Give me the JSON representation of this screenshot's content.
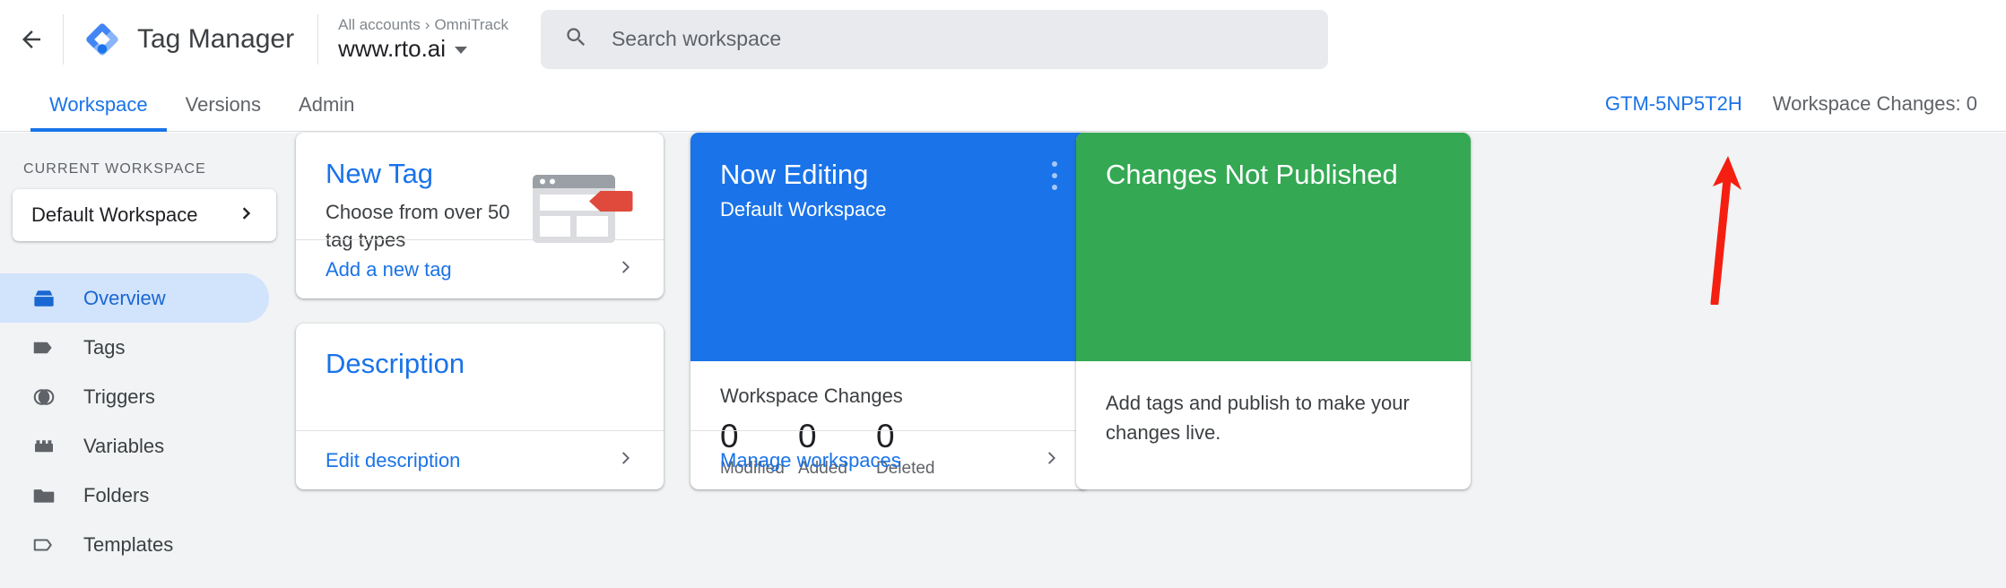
{
  "topbar": {
    "back_icon": "arrow-left-icon",
    "logo_icon": "tag-manager-logo",
    "product_title": "Tag Manager",
    "breadcrumb_root": "All accounts",
    "breadcrumb_sep": "›",
    "breadcrumb_account": "OmniTrack",
    "container_name": "www.rto.ai",
    "container_dropdown_icon": "chevron-down-icon",
    "search": {
      "icon": "search-icon",
      "placeholder": "Search workspace"
    }
  },
  "tabbar": {
    "tabs": [
      {
        "label": "Workspace",
        "active": true
      },
      {
        "label": "Versions",
        "active": false
      },
      {
        "label": "Admin",
        "active": false
      }
    ],
    "container_id": "GTM-5NP5T2H",
    "workspace_changes": "Workspace Changes: 0"
  },
  "sidebar": {
    "section_label": "CURRENT WORKSPACE",
    "workspace_selector": {
      "name": "Default Workspace",
      "icon": "chevron-right-icon"
    },
    "items": [
      {
        "label": "Overview",
        "icon": "overview-box-icon",
        "active": true
      },
      {
        "label": "Tags",
        "icon": "tag-icon",
        "active": false
      },
      {
        "label": "Triggers",
        "icon": "trigger-circle-icon",
        "active": false
      },
      {
        "label": "Variables",
        "icon": "variables-brick-icon",
        "active": false
      },
      {
        "label": "Folders",
        "icon": "folder-icon",
        "active": false
      },
      {
        "label": "Templates",
        "icon": "template-tag-outline-icon",
        "active": false
      }
    ]
  },
  "cards": {
    "new_tag": {
      "title": "New Tag",
      "subtitle": "Choose from over 50 tag types",
      "illustration_icon": "browser-window-tag-illustration",
      "action_label": "Add a new tag",
      "action_icon": "chevron-right-icon"
    },
    "description": {
      "title": "Description",
      "action_label": "Edit description",
      "action_icon": "chevron-right-icon"
    },
    "now_editing": {
      "title": "Now Editing",
      "subtitle": "Default Workspace",
      "menu_icon": "kebab-menu-icon",
      "stats_title": "Workspace Changes",
      "stats": [
        {
          "value": "0",
          "label": "Modified"
        },
        {
          "value": "0",
          "label": "Added"
        },
        {
          "value": "0",
          "label": "Deleted"
        }
      ],
      "action_label": "Manage workspaces",
      "action_icon": "chevron-right-icon"
    },
    "changes_not_published": {
      "title": "Changes Not Published",
      "body": "Add tags and publish to make your changes live."
    }
  },
  "annotation": {
    "arrow_icon": "red-arrow-up-annotation",
    "color": "#f41f10"
  },
  "colors": {
    "accent_blue": "#1a73e8",
    "card_green": "#34a853",
    "page_bg": "#f1f3f4",
    "nav_active_bg": "#d2e3fc",
    "search_bg": "#e8eaed"
  }
}
